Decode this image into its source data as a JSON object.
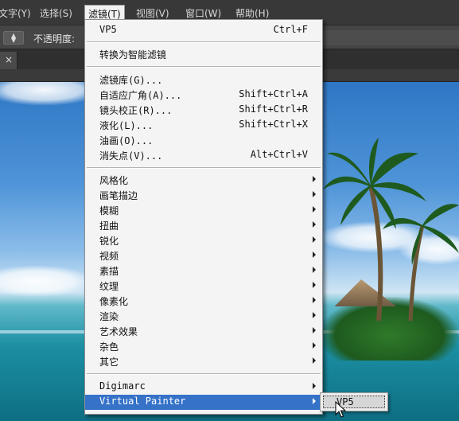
{
  "menubar": {
    "items": [
      {
        "label": "文字(Y)"
      },
      {
        "label": "选择(S)"
      },
      {
        "label": "滤镜(T)"
      },
      {
        "label": "视图(V)"
      },
      {
        "label": "窗口(W)"
      },
      {
        "label": "帮助(H)"
      }
    ]
  },
  "optionsbar": {
    "opacity_label": "不透明度:"
  },
  "tabs": {
    "close_glyph": "×"
  },
  "filter_menu": {
    "items": [
      {
        "label": "VP5",
        "shortcut": "Ctrl+F"
      },
      {
        "label": "转换为智能滤镜"
      },
      {
        "label": "滤镜库(G)..."
      },
      {
        "label": "自适应广角(A)...",
        "shortcut": "Shift+Ctrl+A"
      },
      {
        "label": "镜头校正(R)...",
        "shortcut": "Shift+Ctrl+R"
      },
      {
        "label": "液化(L)...",
        "shortcut": "Shift+Ctrl+X"
      },
      {
        "label": "油画(O)..."
      },
      {
        "label": "消失点(V)...",
        "shortcut": "Alt+Ctrl+V"
      },
      {
        "label": "风格化"
      },
      {
        "label": "画笔描边"
      },
      {
        "label": "模糊"
      },
      {
        "label": "扭曲"
      },
      {
        "label": "锐化"
      },
      {
        "label": "视频"
      },
      {
        "label": "素描"
      },
      {
        "label": "纹理"
      },
      {
        "label": "像素化"
      },
      {
        "label": "渲染"
      },
      {
        "label": "艺术效果"
      },
      {
        "label": "杂色"
      },
      {
        "label": "其它"
      },
      {
        "label": "Digimarc"
      },
      {
        "label": "Virtual Painter"
      }
    ]
  },
  "submenu": {
    "items": [
      {
        "label": "VP5"
      }
    ]
  },
  "colors": {
    "highlight": "#3572c8",
    "menu_bg": "#f4f4f4",
    "app_chrome": "#383838"
  }
}
